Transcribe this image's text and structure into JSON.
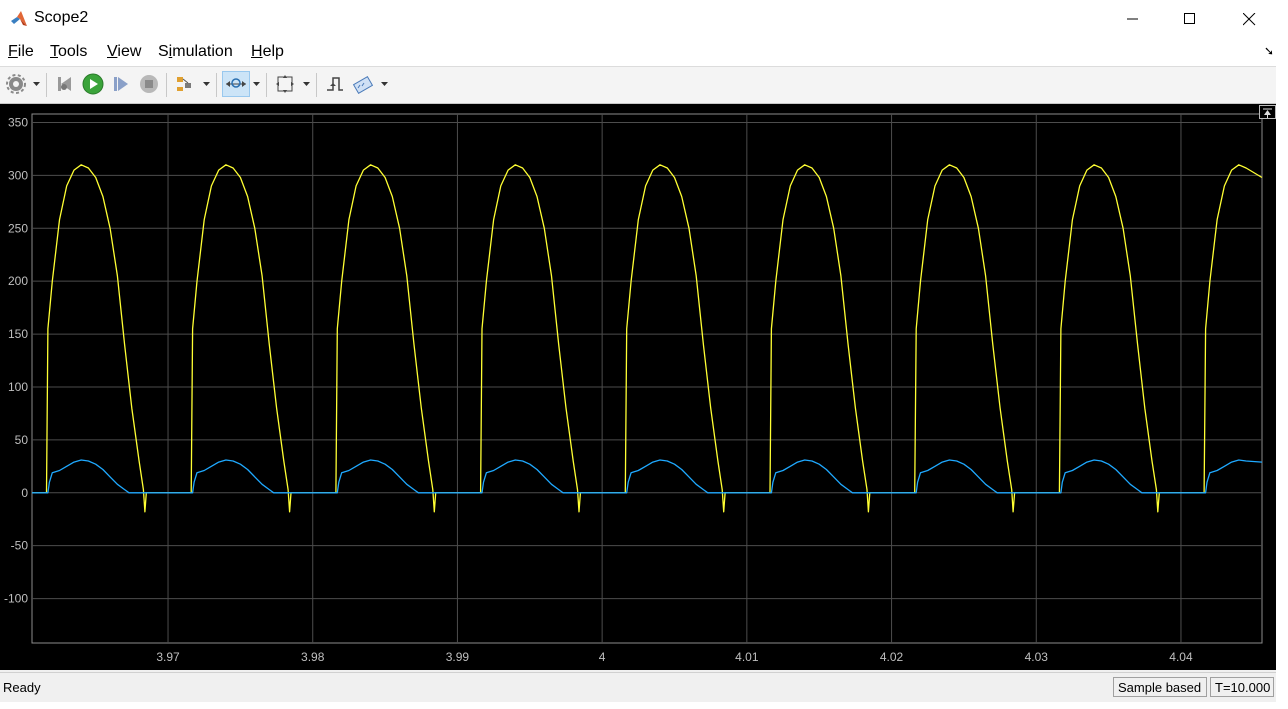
{
  "window": {
    "title": "Scope2",
    "icon": "matlab-logo-icon"
  },
  "menu": [
    {
      "label": "File",
      "mnemonic": "F",
      "rest": "ile"
    },
    {
      "label": "Tools",
      "mnemonic": "T",
      "rest": "ools"
    },
    {
      "label": "View",
      "mnemonic": "V",
      "rest": "iew"
    },
    {
      "label": "Simulation",
      "mnemonic": "i",
      "pre": "S",
      "rest": "mulation"
    },
    {
      "label": "Help",
      "mnemonic": "H",
      "rest": "elp"
    }
  ],
  "toolbar": [
    "settings-gear-icon",
    "step-back-icon",
    "run-icon",
    "step-forward-icon",
    "stop-icon",
    "signal-selector-icon",
    "zoom-icon",
    "autoscale-icon",
    "triggers-icon",
    "measurements-icon"
  ],
  "status": {
    "text": "Ready",
    "mode": "Sample based",
    "time": "T=10.000"
  },
  "colors": {
    "signal1": "#ffff33",
    "signal2": "#1fa9ff",
    "background": "#000000",
    "grid": "#4d4d4d",
    "axis_text": "#bfbfbf"
  },
  "chart_data": {
    "type": "line",
    "title": "",
    "xlabel": "",
    "ylabel": "",
    "xlim": [
      3.9606,
      4.0456
    ],
    "ylim": [
      -142,
      358
    ],
    "yticks": [
      -100,
      -50,
      0,
      50,
      100,
      150,
      200,
      250,
      300,
      350
    ],
    "xticks": [
      3.97,
      3.98,
      3.99,
      4,
      4.01,
      4.02,
      4.03,
      4.04
    ],
    "ytick_labels": [
      "-100",
      "-50",
      "0",
      "50",
      "100",
      "150",
      "200",
      "250",
      "300",
      "350"
    ],
    "xtick_labels": [
      "3.97",
      "3.98",
      "3.99",
      "4",
      "4.01",
      "4.02",
      "4.03",
      "4.04"
    ],
    "grid": true,
    "series": [
      {
        "color": "#ffff33",
        "points": [
          [
            3.9606,
            0
          ],
          [
            3.9616,
            0
          ],
          [
            3.9617,
            155
          ],
          [
            3.962,
            200
          ],
          [
            3.9625,
            258
          ],
          [
            3.963,
            290
          ],
          [
            3.9635,
            305
          ],
          [
            3.964,
            310
          ],
          [
            3.9645,
            307
          ],
          [
            3.965,
            298
          ],
          [
            3.9655,
            280
          ],
          [
            3.966,
            250
          ],
          [
            3.9665,
            205
          ],
          [
            3.967,
            140
          ],
          [
            3.9675,
            80
          ],
          [
            3.968,
            30
          ],
          [
            3.9683,
            3
          ],
          [
            3.9684,
            -18
          ],
          [
            3.9685,
            0
          ],
          [
            3.9716,
            0
          ],
          [
            3.9717,
            155
          ],
          [
            3.972,
            200
          ],
          [
            3.9725,
            258
          ],
          [
            3.973,
            290
          ],
          [
            3.9735,
            305
          ],
          [
            3.974,
            310
          ],
          [
            3.9745,
            307
          ],
          [
            3.975,
            298
          ],
          [
            3.9755,
            280
          ],
          [
            3.976,
            250
          ],
          [
            3.9765,
            205
          ],
          [
            3.977,
            140
          ],
          [
            3.9775,
            80
          ],
          [
            3.978,
            30
          ],
          [
            3.9783,
            3
          ],
          [
            3.9784,
            -18
          ],
          [
            3.9785,
            0
          ],
          [
            3.9816,
            0
          ],
          [
            3.9817,
            155
          ],
          [
            3.982,
            200
          ],
          [
            3.9825,
            258
          ],
          [
            3.983,
            290
          ],
          [
            3.9835,
            305
          ],
          [
            3.984,
            310
          ],
          [
            3.9845,
            307
          ],
          [
            3.985,
            298
          ],
          [
            3.9855,
            280
          ],
          [
            3.986,
            250
          ],
          [
            3.9865,
            205
          ],
          [
            3.987,
            140
          ],
          [
            3.9875,
            80
          ],
          [
            3.988,
            30
          ],
          [
            3.9883,
            3
          ],
          [
            3.9884,
            -18
          ],
          [
            3.9885,
            0
          ],
          [
            3.9916,
            0
          ],
          [
            3.9917,
            155
          ],
          [
            3.992,
            200
          ],
          [
            3.9925,
            258
          ],
          [
            3.993,
            290
          ],
          [
            3.9935,
            305
          ],
          [
            3.994,
            310
          ],
          [
            3.9945,
            307
          ],
          [
            3.995,
            298
          ],
          [
            3.9955,
            280
          ],
          [
            3.996,
            250
          ],
          [
            3.9965,
            205
          ],
          [
            3.997,
            140
          ],
          [
            3.9975,
            80
          ],
          [
            3.998,
            30
          ],
          [
            3.9983,
            3
          ],
          [
            3.9984,
            -18
          ],
          [
            3.9985,
            0
          ],
          [
            4.0016,
            0
          ],
          [
            4.0017,
            155
          ],
          [
            4.002,
            200
          ],
          [
            4.0025,
            258
          ],
          [
            4.003,
            290
          ],
          [
            4.0035,
            305
          ],
          [
            4.004,
            310
          ],
          [
            4.0045,
            307
          ],
          [
            4.005,
            298
          ],
          [
            4.0055,
            280
          ],
          [
            4.006,
            250
          ],
          [
            4.0065,
            205
          ],
          [
            4.007,
            140
          ],
          [
            4.0075,
            80
          ],
          [
            4.008,
            30
          ],
          [
            4.0083,
            3
          ],
          [
            4.0084,
            -18
          ],
          [
            4.0085,
            0
          ],
          [
            4.0116,
            0
          ],
          [
            4.0117,
            155
          ],
          [
            4.012,
            200
          ],
          [
            4.0125,
            258
          ],
          [
            4.013,
            290
          ],
          [
            4.0135,
            305
          ],
          [
            4.014,
            310
          ],
          [
            4.0145,
            307
          ],
          [
            4.015,
            298
          ],
          [
            4.0155,
            280
          ],
          [
            4.016,
            250
          ],
          [
            4.0165,
            205
          ],
          [
            4.017,
            140
          ],
          [
            4.0175,
            80
          ],
          [
            4.018,
            30
          ],
          [
            4.0183,
            3
          ],
          [
            4.0184,
            -18
          ],
          [
            4.0185,
            0
          ],
          [
            4.0216,
            0
          ],
          [
            4.0217,
            155
          ],
          [
            4.022,
            200
          ],
          [
            4.0225,
            258
          ],
          [
            4.023,
            290
          ],
          [
            4.0235,
            305
          ],
          [
            4.024,
            310
          ],
          [
            4.0245,
            307
          ],
          [
            4.025,
            298
          ],
          [
            4.0255,
            280
          ],
          [
            4.026,
            250
          ],
          [
            4.0265,
            205
          ],
          [
            4.027,
            140
          ],
          [
            4.0275,
            80
          ],
          [
            4.028,
            30
          ],
          [
            4.0283,
            3
          ],
          [
            4.0284,
            -18
          ],
          [
            4.0285,
            0
          ],
          [
            4.0316,
            0
          ],
          [
            4.0317,
            155
          ],
          [
            4.032,
            200
          ],
          [
            4.0325,
            258
          ],
          [
            4.033,
            290
          ],
          [
            4.0335,
            305
          ],
          [
            4.034,
            310
          ],
          [
            4.0345,
            307
          ],
          [
            4.035,
            298
          ],
          [
            4.0355,
            280
          ],
          [
            4.036,
            250
          ],
          [
            4.0365,
            205
          ],
          [
            4.037,
            140
          ],
          [
            4.0375,
            80
          ],
          [
            4.038,
            30
          ],
          [
            4.0383,
            3
          ],
          [
            4.0384,
            -18
          ],
          [
            4.0385,
            0
          ],
          [
            4.0416,
            0
          ],
          [
            4.0417,
            155
          ],
          [
            4.042,
            200
          ],
          [
            4.0425,
            258
          ],
          [
            4.043,
            290
          ],
          [
            4.0435,
            305
          ],
          [
            4.044,
            310
          ],
          [
            4.0445,
            307
          ],
          [
            4.0456,
            298
          ]
        ]
      },
      {
        "color": "#1fa9ff",
        "points": [
          [
            3.9606,
            0
          ],
          [
            3.9617,
            0
          ],
          [
            3.9618,
            10
          ],
          [
            3.962,
            19
          ],
          [
            3.9625,
            21
          ],
          [
            3.963,
            25
          ],
          [
            3.9635,
            29
          ],
          [
            3.964,
            31
          ],
          [
            3.9645,
            30
          ],
          [
            3.965,
            27
          ],
          [
            3.9655,
            22
          ],
          [
            3.966,
            15
          ],
          [
            3.9665,
            8
          ],
          [
            3.967,
            3
          ],
          [
            3.9673,
            0
          ],
          [
            3.9717,
            0
          ],
          [
            3.9718,
            10
          ],
          [
            3.972,
            19
          ],
          [
            3.9725,
            21
          ],
          [
            3.973,
            25
          ],
          [
            3.9735,
            29
          ],
          [
            3.974,
            31
          ],
          [
            3.9745,
            30
          ],
          [
            3.975,
            27
          ],
          [
            3.9755,
            22
          ],
          [
            3.976,
            15
          ],
          [
            3.9765,
            8
          ],
          [
            3.977,
            3
          ],
          [
            3.9773,
            0
          ],
          [
            3.9817,
            0
          ],
          [
            3.9818,
            10
          ],
          [
            3.982,
            19
          ],
          [
            3.9825,
            21
          ],
          [
            3.983,
            25
          ],
          [
            3.9835,
            29
          ],
          [
            3.984,
            31
          ],
          [
            3.9845,
            30
          ],
          [
            3.985,
            27
          ],
          [
            3.9855,
            22
          ],
          [
            3.986,
            15
          ],
          [
            3.9865,
            8
          ],
          [
            3.987,
            3
          ],
          [
            3.9873,
            0
          ],
          [
            3.9917,
            0
          ],
          [
            3.9918,
            10
          ],
          [
            3.992,
            19
          ],
          [
            3.9925,
            21
          ],
          [
            3.993,
            25
          ],
          [
            3.9935,
            29
          ],
          [
            3.994,
            31
          ],
          [
            3.9945,
            30
          ],
          [
            3.995,
            27
          ],
          [
            3.9955,
            22
          ],
          [
            3.996,
            15
          ],
          [
            3.9965,
            8
          ],
          [
            3.997,
            3
          ],
          [
            3.9973,
            0
          ],
          [
            4.0017,
            0
          ],
          [
            4.0018,
            10
          ],
          [
            4.002,
            19
          ],
          [
            4.0025,
            21
          ],
          [
            4.003,
            25
          ],
          [
            4.0035,
            29
          ],
          [
            4.004,
            31
          ],
          [
            4.0045,
            30
          ],
          [
            4.005,
            27
          ],
          [
            4.0055,
            22
          ],
          [
            4.006,
            15
          ],
          [
            4.0065,
            8
          ],
          [
            4.007,
            3
          ],
          [
            4.0073,
            0
          ],
          [
            4.0117,
            0
          ],
          [
            4.0118,
            10
          ],
          [
            4.012,
            19
          ],
          [
            4.0125,
            21
          ],
          [
            4.013,
            25
          ],
          [
            4.0135,
            29
          ],
          [
            4.014,
            31
          ],
          [
            4.0145,
            30
          ],
          [
            4.015,
            27
          ],
          [
            4.0155,
            22
          ],
          [
            4.016,
            15
          ],
          [
            4.0165,
            8
          ],
          [
            4.017,
            3
          ],
          [
            4.0173,
            0
          ],
          [
            4.0217,
            0
          ],
          [
            4.0218,
            10
          ],
          [
            4.022,
            19
          ],
          [
            4.0225,
            21
          ],
          [
            4.023,
            25
          ],
          [
            4.0235,
            29
          ],
          [
            4.024,
            31
          ],
          [
            4.0245,
            30
          ],
          [
            4.025,
            27
          ],
          [
            4.0255,
            22
          ],
          [
            4.026,
            15
          ],
          [
            4.0265,
            8
          ],
          [
            4.027,
            3
          ],
          [
            4.0273,
            0
          ],
          [
            4.0317,
            0
          ],
          [
            4.0318,
            10
          ],
          [
            4.032,
            19
          ],
          [
            4.0325,
            21
          ],
          [
            4.033,
            25
          ],
          [
            4.0335,
            29
          ],
          [
            4.034,
            31
          ],
          [
            4.0345,
            30
          ],
          [
            4.035,
            27
          ],
          [
            4.0355,
            22
          ],
          [
            4.036,
            15
          ],
          [
            4.0365,
            8
          ],
          [
            4.037,
            3
          ],
          [
            4.0373,
            0
          ],
          [
            4.0417,
            0
          ],
          [
            4.0418,
            10
          ],
          [
            4.042,
            19
          ],
          [
            4.0425,
            21
          ],
          [
            4.043,
            25
          ],
          [
            4.0435,
            29
          ],
          [
            4.044,
            31
          ],
          [
            4.0445,
            30
          ],
          [
            4.0456,
            29
          ]
        ]
      }
    ]
  }
}
